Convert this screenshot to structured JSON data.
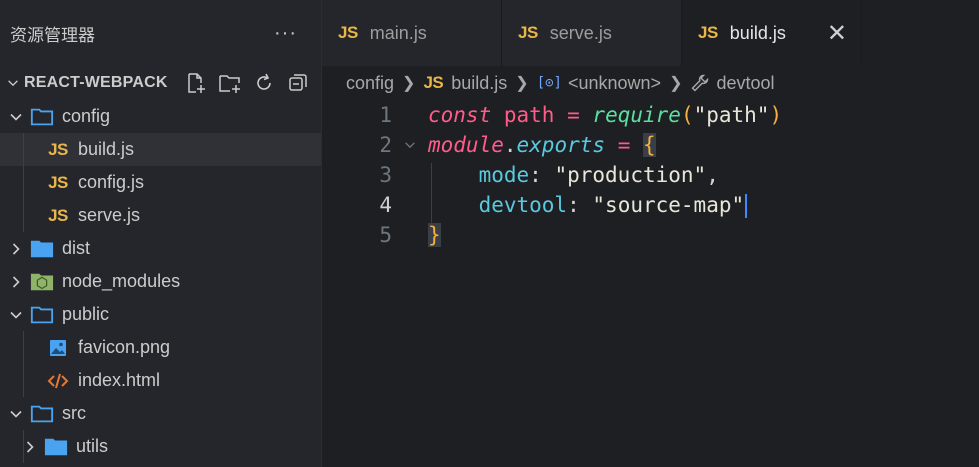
{
  "sidebar": {
    "title": "资源管理器",
    "more_label": "···",
    "project_title": "REACT-WEBPACK",
    "tree": [
      {
        "label": "config",
        "kind": "folder-open",
        "depth": 0,
        "expanded": true
      },
      {
        "label": "build.js",
        "kind": "js",
        "depth": 1,
        "selected": true
      },
      {
        "label": "config.js",
        "kind": "js",
        "depth": 1
      },
      {
        "label": "serve.js",
        "kind": "js",
        "depth": 1
      },
      {
        "label": "dist",
        "kind": "folder",
        "depth": 0,
        "expanded": false
      },
      {
        "label": "node_modules",
        "kind": "node-folder",
        "depth": 0,
        "expanded": false
      },
      {
        "label": "public",
        "kind": "folder-open",
        "depth": 0,
        "expanded": true
      },
      {
        "label": "favicon.png",
        "kind": "image",
        "depth": 1
      },
      {
        "label": "index.html",
        "kind": "html",
        "depth": 1
      },
      {
        "label": "src",
        "kind": "folder-open",
        "depth": 0,
        "expanded": true
      },
      {
        "label": "utils",
        "kind": "folder",
        "depth": 1,
        "expanded": false
      }
    ]
  },
  "tabs": [
    {
      "label": "main.js",
      "badge": "JS",
      "active": false
    },
    {
      "label": "serve.js",
      "badge": "JS",
      "active": false
    },
    {
      "label": "build.js",
      "badge": "JS",
      "active": true,
      "close": "✕"
    }
  ],
  "breadcrumb": {
    "folder": "config",
    "file_badge": "JS",
    "file": "build.js",
    "symbol_icon": "[⊙]",
    "symbol": "<unknown>",
    "property": "devtool"
  },
  "editor": {
    "active_line": 4,
    "line_numbers": [
      "1",
      "2",
      "3",
      "4",
      "5"
    ],
    "tokens": {
      "l1_const": "const",
      "l1_path": "path",
      "l1_eq": "=",
      "l1_require": "require",
      "l1_open": "(",
      "l1_str": "\"path\"",
      "l1_close": ")",
      "l2_module": "module",
      "l2_dot": ".",
      "l2_exports": "exports",
      "l2_eq": "=",
      "l2_brace": "{",
      "l3_key": "mode",
      "l3_colon": ":",
      "l3_str": "\"production\"",
      "l3_comma": ",",
      "l4_key": "devtool",
      "l4_colon": ":",
      "l4_str": "\"source-map\"",
      "l5_brace": "}"
    }
  },
  "colors": {
    "accent": "#3b8bff",
    "js_badge": "#e8b649",
    "folder": "#4aa3f0"
  }
}
